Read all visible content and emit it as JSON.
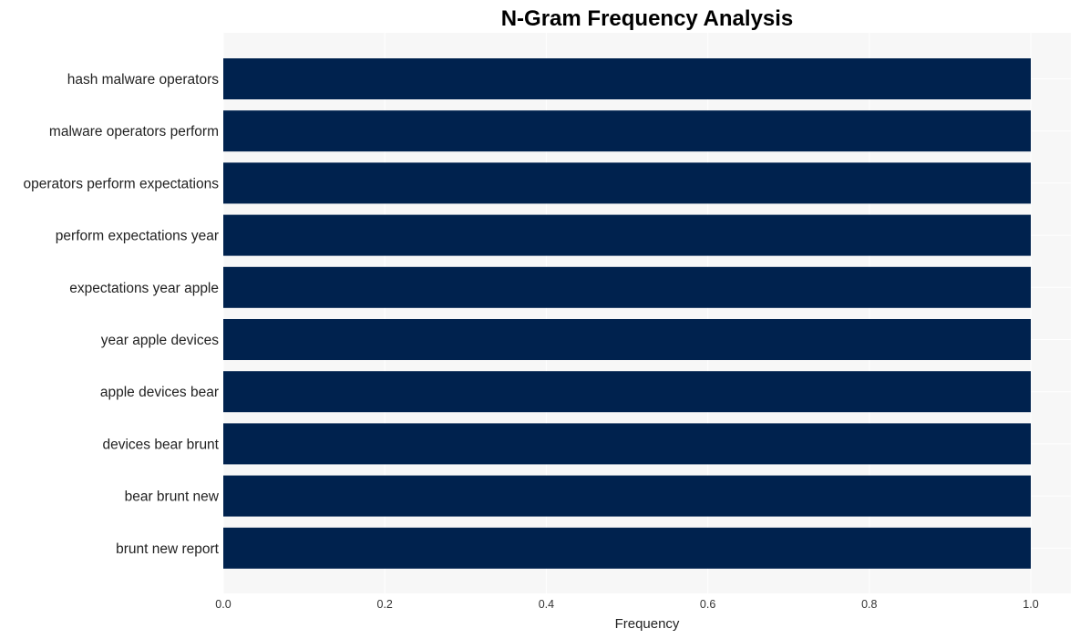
{
  "chart_data": {
    "type": "bar",
    "orientation": "horizontal",
    "title": "N-Gram Frequency Analysis",
    "xlabel": "Frequency",
    "ylabel": "",
    "categories": [
      "hash malware operators",
      "malware operators perform",
      "operators perform expectations",
      "perform expectations year",
      "expectations year apple",
      "year apple devices",
      "apple devices bear",
      "devices bear brunt",
      "bear brunt new",
      "brunt new report"
    ],
    "values": [
      1,
      1,
      1,
      1,
      1,
      1,
      1,
      1,
      1,
      1
    ],
    "xlim": [
      0,
      1.05
    ],
    "xticks": [
      0.0,
      0.2,
      0.4,
      0.6,
      0.8,
      1.0
    ],
    "xtick_labels": [
      "0.0",
      "0.2",
      "0.4",
      "0.6",
      "0.8",
      "1.0"
    ],
    "grid": true,
    "legend": "none",
    "colors": {
      "bar": "#00224e",
      "plot_background": "#f7f7f7",
      "grid": "#ffffff"
    }
  }
}
